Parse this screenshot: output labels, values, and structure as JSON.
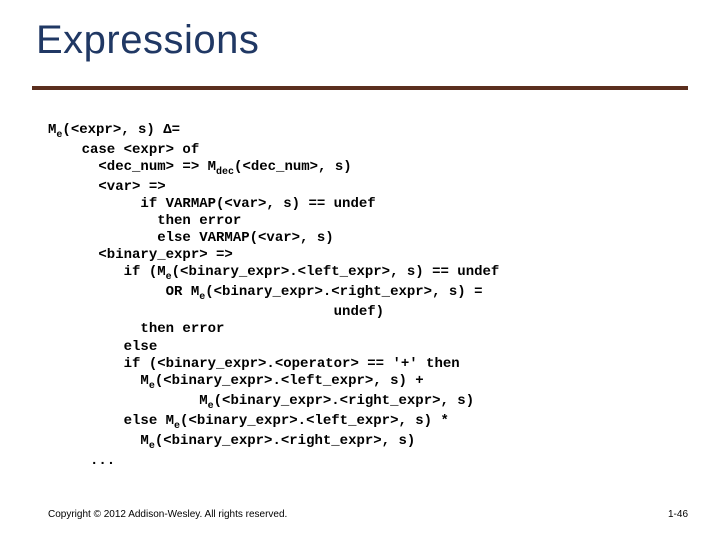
{
  "title": "Expressions",
  "code": {
    "l01a": "M",
    "l01b": "(<expr>, s) Δ=",
    "l02": "    case <expr> of",
    "l03a": "      <dec_num> => M",
    "l03b": "(<dec_num>, s)",
    "l04": "      <var> =>",
    "l05": "           if VARMAP(<var>, s) == undef",
    "l06": "             then error",
    "l07": "             else VARMAP(<var>, s)",
    "l08": "      <binary_expr> =>",
    "l09a": "         if (M",
    "l09b": "(<binary_expr>.<left_expr>, s) == undef",
    "l10a": "              OR M",
    "l10b": "(<binary_expr>.<right_expr>, s) =",
    "l11": "                                  undef)",
    "l12": "           then error",
    "l13": "         else",
    "l14": "         if (<binary_expr>.<operator> == '+' then",
    "l15a": "           M",
    "l15b": "(<binary_expr>.<left_expr>, s) +",
    "l16a": "                  M",
    "l16b": "(<binary_expr>.<right_expr>, s)",
    "l17a": "         else M",
    "l17b": "(<binary_expr>.<left_expr>, s) *",
    "l18a": "           M",
    "l18b": "(<binary_expr>.<right_expr>, s)",
    "l19": "     ...",
    "sub_e": "e",
    "sub_dec": "dec"
  },
  "footer": {
    "copyright": "Copyright © 2012 Addison-Wesley. All rights reserved.",
    "page": "1-46"
  }
}
